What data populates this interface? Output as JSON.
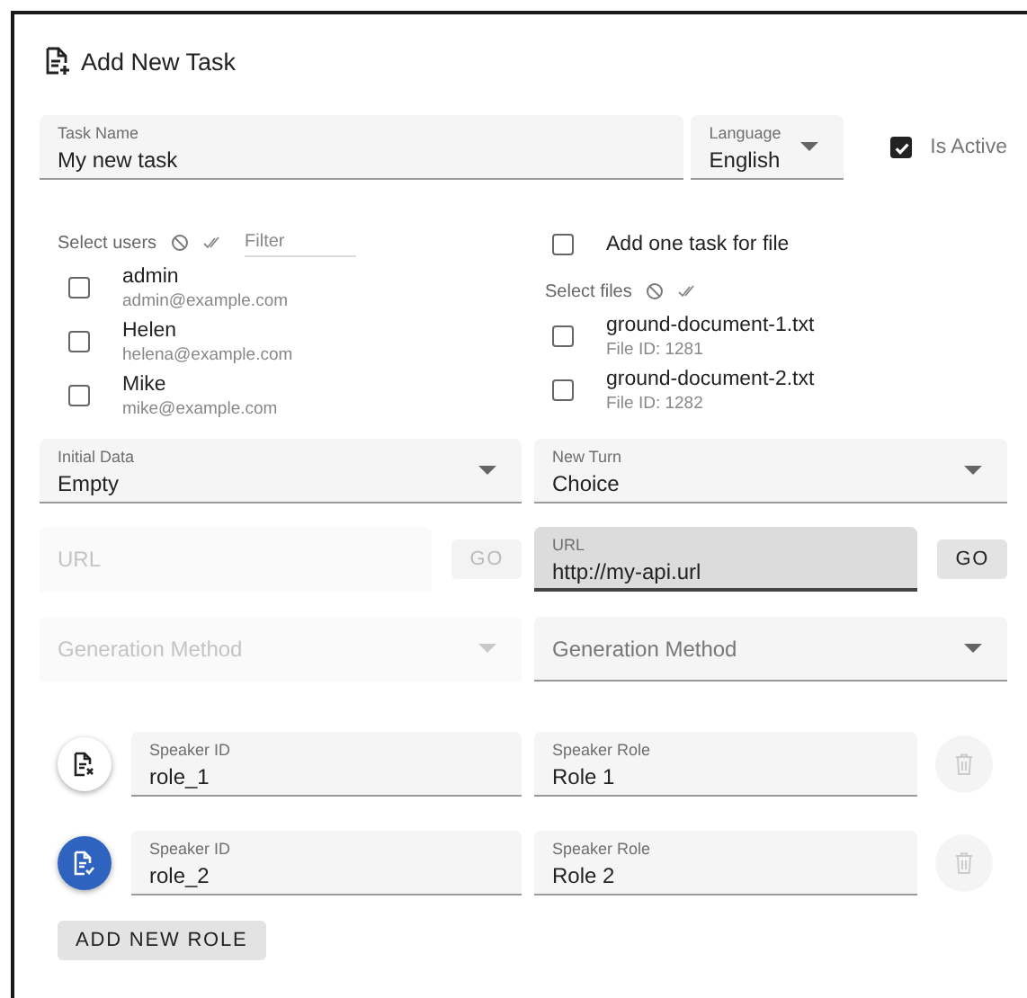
{
  "title": "Add New Task",
  "task_name": {
    "label": "Task Name",
    "value": "My new task"
  },
  "language": {
    "label": "Language",
    "value": "English"
  },
  "is_active": {
    "label": "Is Active",
    "checked": true
  },
  "users": {
    "label": "Select users",
    "filter_placeholder": "Filter",
    "items": [
      {
        "name": "admin",
        "email": "admin@example.com",
        "checked": false
      },
      {
        "name": "Helen",
        "email": "helena@example.com",
        "checked": false
      },
      {
        "name": "Mike",
        "email": "mike@example.com",
        "checked": false
      }
    ]
  },
  "one_task_per_file": {
    "label": "Add one task for file",
    "checked": false
  },
  "files": {
    "label": "Select files",
    "items": [
      {
        "name": "ground-document-1.txt",
        "detail": "File ID: 1281",
        "checked": false
      },
      {
        "name": "ground-document-2.txt",
        "detail": "File ID: 1282",
        "checked": false
      }
    ]
  },
  "initial_data": {
    "label": "Initial Data",
    "value": "Empty"
  },
  "new_turn": {
    "label": "New Turn",
    "value": "Choice"
  },
  "url_fields": [
    {
      "placeholder": "URL",
      "disabled": true,
      "focused": false,
      "button": "GO"
    },
    {
      "label": "URL",
      "value": "http://my-api.url",
      "disabled": false,
      "focused": true,
      "button": "GO"
    }
  ],
  "generation_fields": [
    {
      "placeholder": "Generation Method",
      "disabled": true
    },
    {
      "placeholder": "Generation Method",
      "disabled": false
    }
  ],
  "roles": [
    {
      "id_label": "Speaker ID",
      "id": "role_1",
      "role_label": "Speaker Role",
      "role": "Role 1",
      "selected": false
    },
    {
      "id_label": "Speaker ID",
      "id": "role_2",
      "role_label": "Speaker Role",
      "role": "Role 2",
      "selected": true
    }
  ],
  "add_button": "ADD NEW ROLE"
}
